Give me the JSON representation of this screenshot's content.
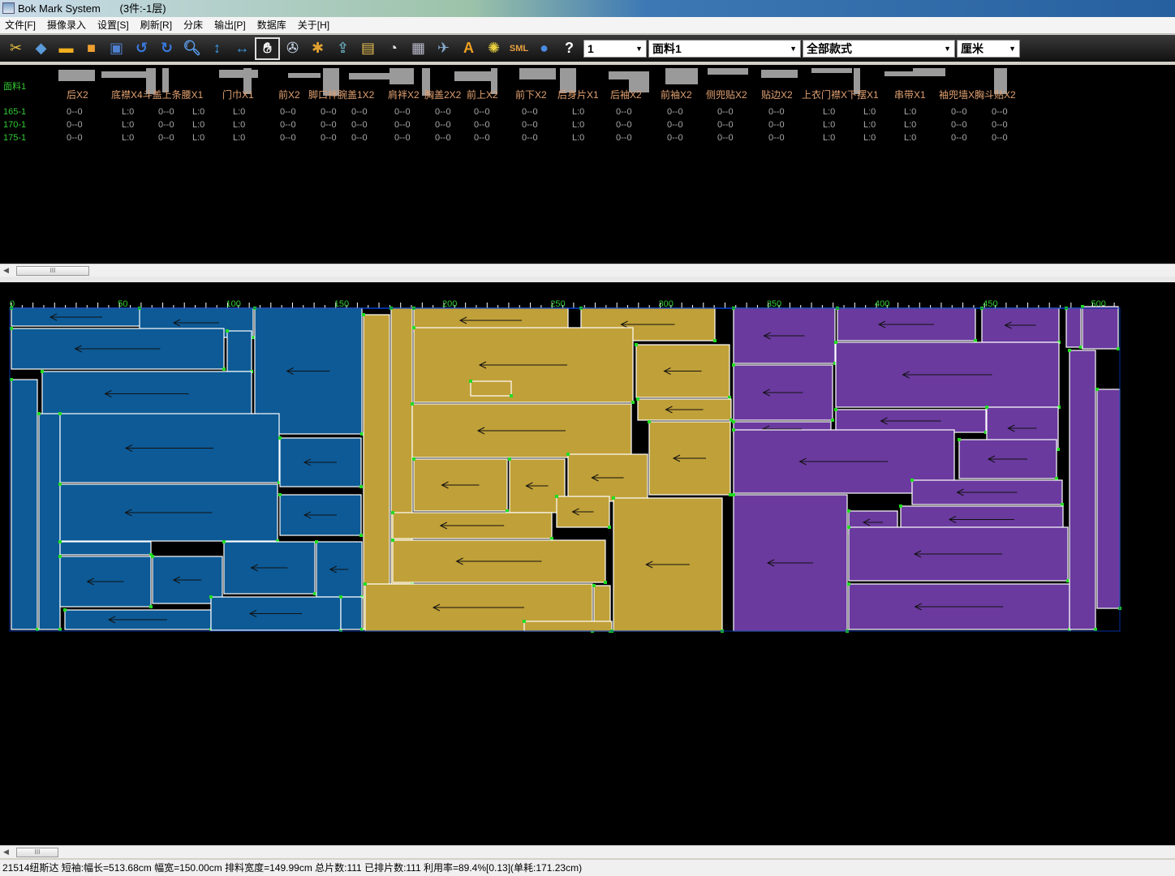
{
  "window": {
    "title": "Bok Mark System",
    "subtitle": "(3件:-1层)"
  },
  "menu": [
    "文件[F]",
    "摄像录入",
    "设置[S]",
    "刷新[R]",
    "分床",
    "输出[P]",
    "数据库",
    "关于[H]"
  ],
  "toolbar": {
    "icons": [
      "scissors-icon",
      "layers-icon",
      "open-folder-icon",
      "save-icon",
      "new-folder-icon",
      "undo-icon",
      "redo-icon",
      "zoom-icon",
      "vertical-flip-icon",
      "horizontal-flip-icon",
      "hand-icon",
      "reel-icon",
      "puzzle-icon",
      "upload-icon",
      "film-icon",
      "tape-icon",
      "calendar-icon",
      "satellite-icon",
      "text-icon",
      "color-wheel-icon",
      "sml-icon",
      "globe-icon",
      "help-icon"
    ],
    "selected": "hand-icon",
    "sml_label": "SML",
    "text_label": "A",
    "help_label": "?",
    "combos": [
      {
        "value": "1"
      },
      {
        "value": "面料1"
      },
      {
        "value": "全部款式"
      },
      {
        "value": "厘米"
      }
    ]
  },
  "sizes_table": {
    "fabric_label": "面料1",
    "headers": [
      "后X2",
      "底襟X4斗盖上条腰X1",
      "门巾X1",
      "前X2",
      "脚口袢腕盖1X2",
      "肩袢X2",
      "胸盖2X2",
      "前上X2",
      "前下X2",
      "后身片X1",
      "后袖X2",
      "前袖X2",
      "侧兜贴X2",
      "贴边X2",
      "上衣门襟X下摆X1",
      "串带X1",
      "袖兜墙X胸斗贴X2"
    ],
    "rows": [
      {
        "size": "165-1",
        "values": [
          "0--0",
          "L:0",
          "0--0",
          "L:0",
          "L:0",
          "0--0",
          "0--0",
          "0--0",
          "0--0",
          "0--0",
          "0--0",
          "0--0",
          "L:0",
          "0--0",
          "0--0",
          "0--0",
          "0--0",
          "L:0",
          "L:0",
          "L:0",
          "0--0",
          "0--0"
        ]
      },
      {
        "size": "170-1",
        "values": [
          "0--0",
          "L:0",
          "0--0",
          "L:0",
          "L:0",
          "0--0",
          "0--0",
          "0--0",
          "0--0",
          "0--0",
          "0--0",
          "0--0",
          "L:0",
          "0--0",
          "0--0",
          "0--0",
          "0--0",
          "L:0",
          "L:0",
          "L:0",
          "0--0",
          "0--0"
        ]
      },
      {
        "size": "175-1",
        "values": [
          "0--0",
          "L:0",
          "0--0",
          "L:0",
          "L:0",
          "0--0",
          "0--0",
          "0--0",
          "0--0",
          "0--0",
          "0--0",
          "0--0",
          "L:0",
          "0--0",
          "0--0",
          "0--0",
          "0--0",
          "L:0",
          "L:0",
          "L:0",
          "0--0",
          "0--0"
        ]
      }
    ]
  },
  "marker": {
    "ruler_labels": [
      "0",
      "50",
      "100",
      "150",
      "200",
      "250",
      "300",
      "350",
      "400",
      "450",
      "500"
    ],
    "colors": {
      "size_165": "#0d5a96",
      "size_170": "#c0a038",
      "size_175": "#6a3a9e",
      "outline": "#ffffff",
      "notch": "#22dd22"
    }
  },
  "scroll_label": "III",
  "status": "21514纽斯达 短袖:幅长=513.68cm 幅宽=150.00cm 排料宽度=149.99cm 总片数:111 已排片数:111  利用率=89.4%[0.13](单耗:171.23cm)"
}
